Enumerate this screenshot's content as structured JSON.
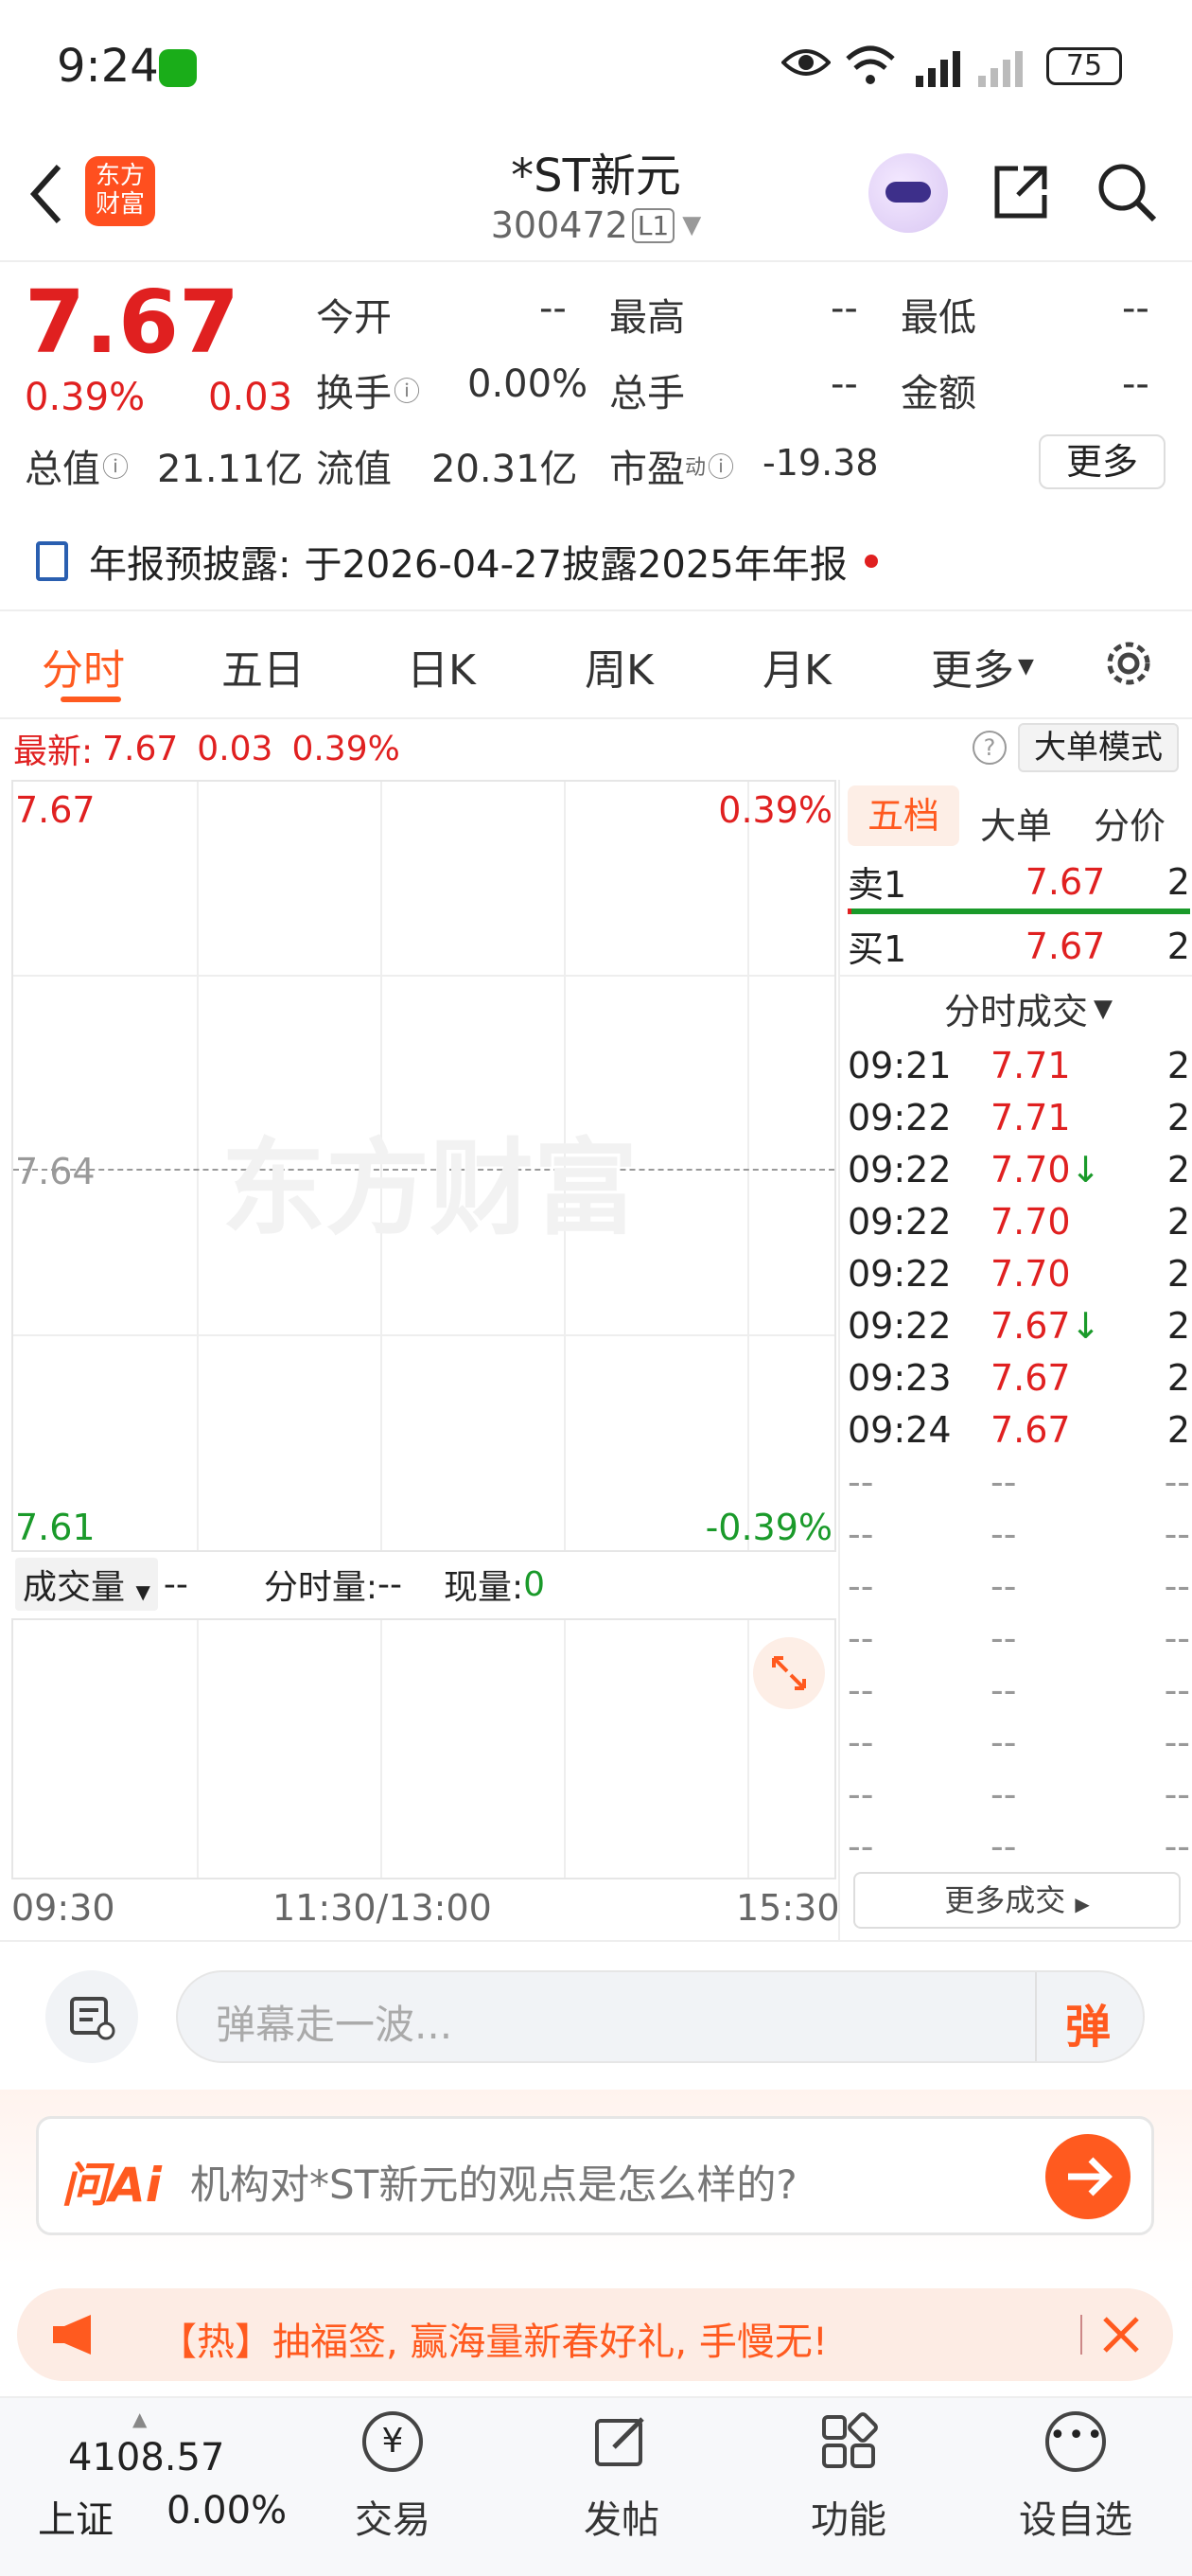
{
  "status_bar": {
    "time": "9:24",
    "battery": "75"
  },
  "header": {
    "logo_text_1": "东方",
    "logo_text_2": "财富",
    "title": "*ST新元",
    "code": "300472",
    "level": "L1"
  },
  "quote": {
    "price": "7.67",
    "change_pct": "0.39%",
    "change": "0.03",
    "open_label": "今开",
    "open_val": "--",
    "high_label": "最高",
    "high_val": "--",
    "low_label": "最低",
    "low_val": "--",
    "turnover_label": "换手",
    "turnover_val": "0.00%",
    "volume_label": "总手",
    "volume_val": "--",
    "amount_label": "金额",
    "amount_val": "--",
    "mcap_label": "总值",
    "mcap_val": "21.11亿",
    "float_label": "流值",
    "float_val": "20.31亿",
    "pe_label": "市盈",
    "pe_sup": "动",
    "pe_val": "-19.38",
    "more_label": "更多"
  },
  "notice": {
    "label": "年报预披露:",
    "text": "于2026-04-27披露2025年年报"
  },
  "tabs": [
    "分时",
    "五日",
    "日K",
    "周K",
    "月K",
    "更多"
  ],
  "latest": {
    "label": "最新:",
    "price": "7.67",
    "change": "0.03",
    "pct": "0.39%",
    "mode_button": "大单模式"
  },
  "chart": {
    "y_top": "7.67",
    "y_mid": "7.64",
    "y_bottom": "7.61",
    "pct_top": "0.39%",
    "pct_bottom": "-0.39%",
    "watermark": "东方财富",
    "vol_dropdown": "成交量",
    "vol_val": "--",
    "period_vol_label": "分时量:",
    "period_vol_val": "--",
    "curr_vol_label": "现量:",
    "curr_vol_val": "0",
    "x_start": "09:30",
    "x_mid": "11:30/13:00",
    "x_end": "15:30"
  },
  "chart_data": {
    "type": "line",
    "title": "",
    "xlabel": "",
    "ylabel": "",
    "x": [
      "09:30",
      "11:30/13:00",
      "15:30"
    ],
    "ylim": [
      7.61,
      7.67
    ],
    "series": [
      {
        "values": []
      }
    ]
  },
  "order_book": {
    "tabs": [
      "五档",
      "大单",
      "分价"
    ],
    "sell1": {
      "label": "卖1",
      "price": "7.67",
      "qty": "2"
    },
    "buy1": {
      "label": "买1",
      "price": "7.67",
      "qty": "2"
    },
    "trades_header": "分时成交",
    "trades": [
      {
        "time": "09:21",
        "price": "7.71",
        "arrow": "",
        "qty": "2"
      },
      {
        "time": "09:22",
        "price": "7.71",
        "arrow": "",
        "qty": "2"
      },
      {
        "time": "09:22",
        "price": "7.70",
        "arrow": "↓",
        "qty": "2"
      },
      {
        "time": "09:22",
        "price": "7.70",
        "arrow": "",
        "qty": "2"
      },
      {
        "time": "09:22",
        "price": "7.70",
        "arrow": "",
        "qty": "2"
      },
      {
        "time": "09:22",
        "price": "7.67",
        "arrow": "↓",
        "qty": "2"
      },
      {
        "time": "09:23",
        "price": "7.67",
        "arrow": "",
        "qty": "2"
      },
      {
        "time": "09:24",
        "price": "7.67",
        "arrow": "",
        "qty": "2"
      },
      {
        "time": "--",
        "price": "--",
        "arrow": "",
        "qty": "--"
      },
      {
        "time": "--",
        "price": "--",
        "arrow": "",
        "qty": "--"
      },
      {
        "time": "--",
        "price": "--",
        "arrow": "",
        "qty": "--"
      },
      {
        "time": "--",
        "price": "--",
        "arrow": "",
        "qty": "--"
      },
      {
        "time": "--",
        "price": "--",
        "arrow": "",
        "qty": "--"
      },
      {
        "time": "--",
        "price": "--",
        "arrow": "",
        "qty": "--"
      },
      {
        "time": "--",
        "price": "--",
        "arrow": "",
        "qty": "--"
      },
      {
        "time": "--",
        "price": "--",
        "arrow": "",
        "qty": "--"
      }
    ],
    "more_trades": "更多成交"
  },
  "danmaku": {
    "placeholder": "弹幕走一波...",
    "button": "弹"
  },
  "ai": {
    "logo": "问Ai",
    "question": "机构对*ST新元的观点是怎么样的?"
  },
  "promo": {
    "text": "【热】抽福签, 赢海量新春好礼, 手慢无!"
  },
  "bottom_nav": {
    "index_value": "4108.57",
    "index_name": "上证",
    "index_pct": "0.00%",
    "items": [
      "交易",
      "发帖",
      "功能",
      "设自选"
    ]
  },
  "colors": {
    "red": "#e02020",
    "green": "#1a9a2a",
    "orange": "#ff5a1f"
  }
}
